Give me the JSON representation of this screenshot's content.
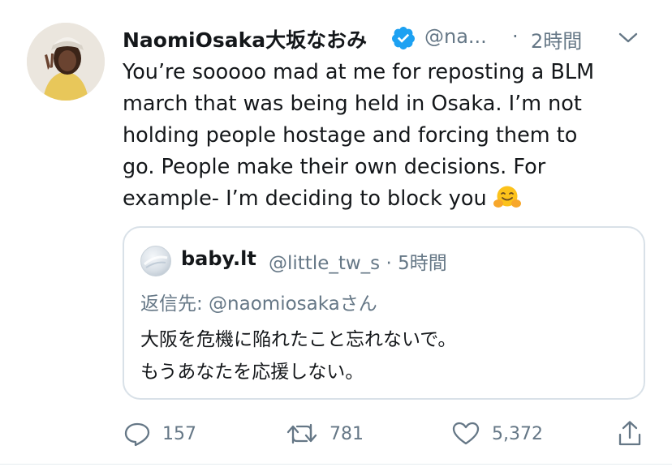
{
  "tweet": {
    "author_name": "NaomiOsaka大坂なおみ",
    "handle": "@na...",
    "separator": "·",
    "time": "2時間",
    "text": "You’re sooooo mad at me for reposting a BLM\nmarch that was being held in Osaka. I’m not\nholding people hostage and forcing them to\ngo. People make their own decisions. For\nexample- I’m deciding to block you",
    "emoji": "hugging-face-emoji",
    "verified_color": "#1da1f2"
  },
  "quoted": {
    "author_name": "baby.lt",
    "handle_time": "@little_tw_s · 5時間",
    "reply_to": "返信先: @naomiosakaさん",
    "text": "大阪を危機に陥れたこと忘れないで。\nもうあなたを応援しない。"
  },
  "actions": {
    "reply_count": "157",
    "retweet_count": "781",
    "like_count": "5,372",
    "icons": [
      "reply-icon",
      "retweet-icon",
      "like-icon",
      "share-icon"
    ]
  },
  "colors": {
    "text": "#14171a",
    "secondary": "#657786",
    "border": "#d9e1e8",
    "accent": "#1da1f2"
  }
}
